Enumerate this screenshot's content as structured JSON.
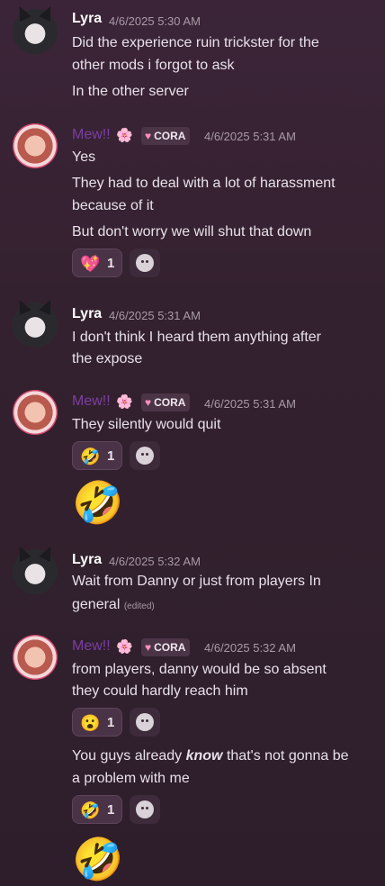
{
  "messages": [
    {
      "author": "Lyra",
      "timestamp": "4/6/2025 5:30 AM",
      "lines": [
        "Did the experience ruin trickster for the",
        "other mods i forgot to ask",
        "In the other server"
      ]
    },
    {
      "author": "Mew!!",
      "flower": "🌸",
      "tag": {
        "icon": "heart",
        "label": "CORA"
      },
      "timestamp": "4/6/2025 5:31 AM",
      "lines": [
        "Yes",
        "They had to deal with a lot of harassment",
        "because of it",
        "But don't worry we will shut that down"
      ],
      "reactions": [
        {
          "emoji": "💖",
          "count": "1"
        }
      ]
    },
    {
      "author": "Lyra",
      "timestamp": "4/6/2025 5:31 AM",
      "lines": [
        "I don't think I heard them anything  after",
        "the expose"
      ]
    },
    {
      "author": "Mew!!",
      "flower": "🌸",
      "tag": {
        "icon": "heart",
        "label": "CORA"
      },
      "timestamp": "4/6/2025 5:31 AM",
      "lines": [
        "They silently would quit"
      ],
      "reactions": [
        {
          "emoji": "🤣",
          "count": "1"
        }
      ],
      "big_emoji": "🤣"
    },
    {
      "author": "Lyra",
      "timestamp": "4/6/2025 5:32 AM",
      "lines": [
        "Wait from Danny or just from players In",
        "general"
      ],
      "edited": "(edited)"
    },
    {
      "author": "Mew!!",
      "flower": "🌸",
      "tag": {
        "icon": "heart",
        "label": "CORA"
      },
      "timestamp": "4/6/2025 5:32 AM",
      "lines": [
        "from players, danny would be so absent",
        "they could hardly reach him"
      ],
      "reactions": [
        {
          "emoji": "😮",
          "count": "1"
        }
      ],
      "followup": {
        "before": "You guys already ",
        "emph": "know",
        "after": " that's not gonna be",
        "line2": "a problem with me"
      },
      "followup_reactions": [
        {
          "emoji": "🤣",
          "count": "1"
        }
      ],
      "big_emoji": "🤣"
    }
  ],
  "colors": {
    "background": "#34212f",
    "mew_name": "#7b3fa1",
    "timestamp": "#a89aa6"
  }
}
